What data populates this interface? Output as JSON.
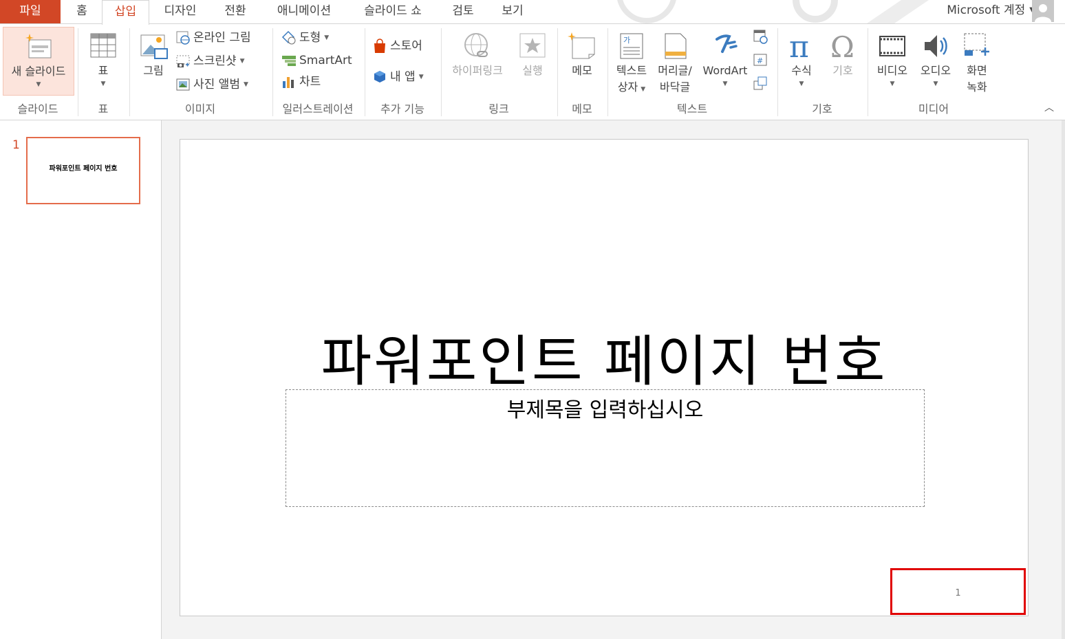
{
  "tabs": {
    "file": "파일",
    "home": "홈",
    "insert": "삽입",
    "design": "디자인",
    "transitions": "전환",
    "animations": "애니메이션",
    "slideshow": "슬라이드 쇼",
    "review": "검토",
    "view": "보기"
  },
  "account": {
    "label": "Microsoft 계정"
  },
  "ribbon": {
    "slides": {
      "group_label": "슬라이드",
      "new_slide": "새 슬라이드"
    },
    "tables": {
      "group_label": "표",
      "table": "표"
    },
    "images": {
      "group_label": "이미지",
      "picture": "그림",
      "online_pictures": "온라인 그림",
      "screenshot": "스크린샷",
      "photo_album": "사진 앨범"
    },
    "illustrations": {
      "group_label": "일러스트레이션",
      "shapes": "도형",
      "smartart": "SmartArt",
      "chart": "차트"
    },
    "addins": {
      "group_label": "추가 기능",
      "store": "스토어",
      "my_apps": "내 앱"
    },
    "links": {
      "group_label": "링크",
      "hyperlink": "하이퍼링크",
      "action": "실행"
    },
    "comments": {
      "group_label": "메모",
      "comment": "메모"
    },
    "text": {
      "group_label": "텍스트",
      "textbox_line1": "텍스트",
      "textbox_line2": "상자",
      "headerfooter_line1": "머리글/",
      "headerfooter_line2": "바닥글",
      "wordart": "WordArt"
    },
    "symbols": {
      "group_label": "기호",
      "equation": "수식",
      "symbol": "기호"
    },
    "media": {
      "group_label": "미디어",
      "video": "비디오",
      "audio": "오디오",
      "screenrec_line1": "화면",
      "screenrec_line2": "녹화"
    }
  },
  "thumbnails": [
    {
      "number": "1",
      "title": "파워포인트 페이지 번호"
    }
  ],
  "slide": {
    "title": "파워포인트 페이지 번호",
    "subtitle": "부제목을 입력하십시오",
    "page_number": "1"
  },
  "colors": {
    "accent": "#d24726",
    "highlight_box": "#e00000"
  }
}
